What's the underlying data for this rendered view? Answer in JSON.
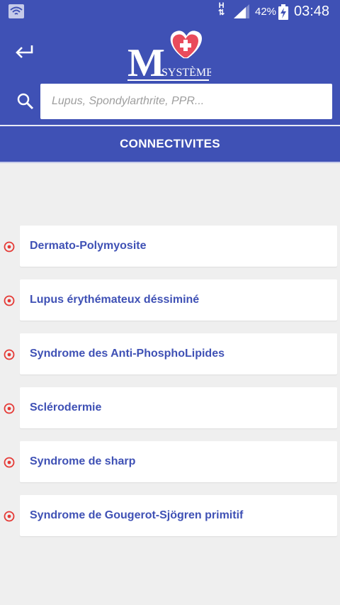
{
  "status_bar": {
    "network_type": "H",
    "battery_percent": "42%",
    "time": "03:48"
  },
  "header": {
    "logo_letter": "M",
    "logo_word": "SYSTÈME",
    "search_placeholder": "Lupus, Spondylarthrite, PPR..."
  },
  "section": {
    "title": "CONNECTIVITES"
  },
  "items": [
    {
      "label": "Dermato-Polymyosite"
    },
    {
      "label": "Lupus érythémateux déssiminé"
    },
    {
      "label": "Syndrome des Anti-PhosphoLipides"
    },
    {
      "label": "Sclérodermie"
    },
    {
      "label": "Syndrome de sharp"
    },
    {
      "label": "Syndrome de Gougerot-Sjögren primitif"
    }
  ],
  "colors": {
    "primary": "#3f51b5",
    "accent": "#e53935",
    "background": "#efefef"
  }
}
